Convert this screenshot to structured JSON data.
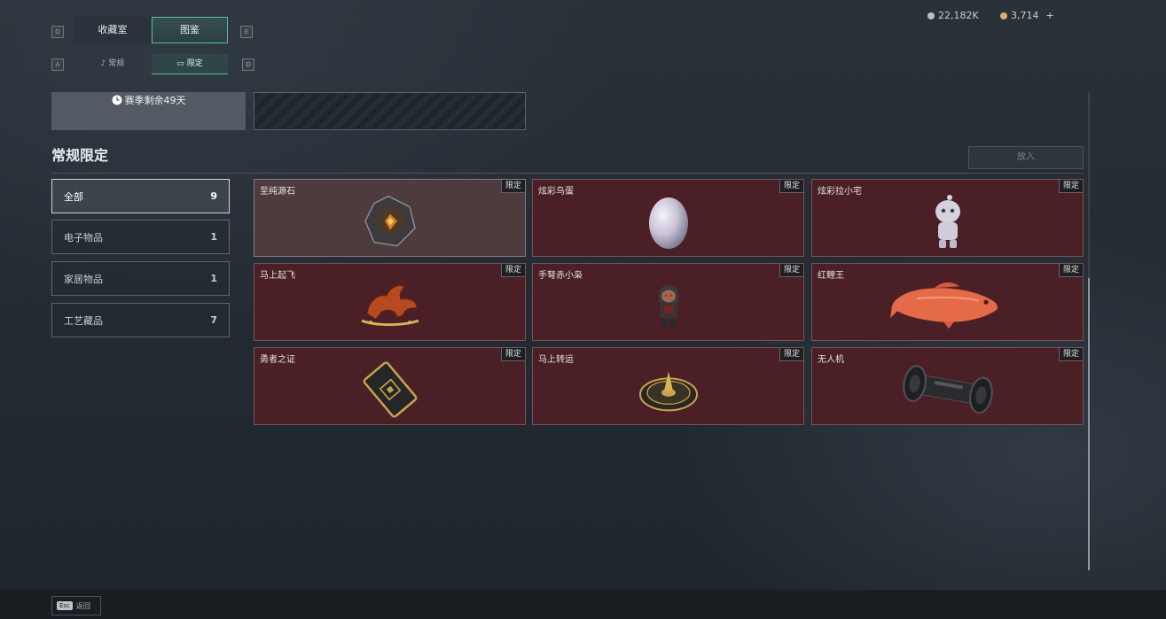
{
  "hotkeys": {
    "prev_main": "Q",
    "next_main": "E",
    "prev_sub": "A",
    "next_sub": "D"
  },
  "main_tabs": [
    {
      "label": "收藏室"
    },
    {
      "label": "图鉴"
    }
  ],
  "sub_tabs": [
    {
      "label": "常规"
    },
    {
      "label": "限定"
    }
  ],
  "currency": [
    {
      "value": "22,182K",
      "color": "#b9bfc4"
    },
    {
      "value": "3,714",
      "color": "#d8b06a"
    }
  ],
  "currency_add": "+",
  "season": {
    "text": "赛季剩余49天"
  },
  "section_title": "常规限定",
  "put_button": "放入",
  "categories": [
    {
      "label": "全部",
      "count": "9"
    },
    {
      "label": "电子物品",
      "count": "1"
    },
    {
      "label": "家居物品",
      "count": "1"
    },
    {
      "label": "工艺藏品",
      "count": "7"
    }
  ],
  "items": [
    {
      "name": "至纯源石",
      "badge": "限定",
      "icon": "crystal-icon"
    },
    {
      "name": "炫彩鸟蛋",
      "badge": "限定",
      "icon": "egg-icon"
    },
    {
      "name": "炫彩拉小宅",
      "badge": "限定",
      "icon": "figure-icon"
    },
    {
      "name": "马上起飞",
      "badge": "限定",
      "icon": "horse-icon"
    },
    {
      "name": "手弩赤小枭",
      "badge": "限定",
      "icon": "doll-icon"
    },
    {
      "name": "红鲤王",
      "badge": "限定",
      "icon": "fish-icon"
    },
    {
      "name": "勇者之证",
      "badge": "限定",
      "icon": "card-icon"
    },
    {
      "name": "马上转运",
      "badge": "限定",
      "icon": "compass-icon"
    },
    {
      "name": "无人机",
      "badge": "限定",
      "icon": "drone-part-icon"
    }
  ],
  "footer": {
    "key": "Esc",
    "label": "返回"
  }
}
